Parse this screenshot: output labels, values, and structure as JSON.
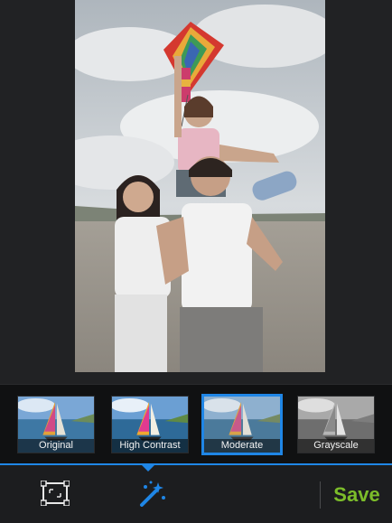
{
  "filters": [
    {
      "label": "Original",
      "selected": false
    },
    {
      "label": "High Contrast",
      "selected": false
    },
    {
      "label": "Moderate",
      "selected": true
    },
    {
      "label": "Grayscale",
      "selected": false
    }
  ],
  "toolbar": {
    "crop_icon": "crop-frame-icon",
    "effects_icon": "magic-wand-icon",
    "save_label": "Save"
  },
  "colors": {
    "accent": "#1f86e6",
    "save": "#7cbd2a",
    "background": "#1e1f21"
  }
}
